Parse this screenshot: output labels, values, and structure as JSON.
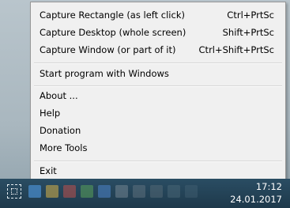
{
  "menu": {
    "items": [
      {
        "label": "Capture Rectangle (as left click)",
        "shortcut": "Ctrl+PrtSc"
      },
      {
        "label": "Capture Desktop (whole screen)",
        "shortcut": "Shift+PrtSc"
      },
      {
        "label": "Capture Window (or part of it)",
        "shortcut": "Ctrl+Shift+PrtSc"
      },
      {
        "label": "Start program with Windows",
        "shortcut": ""
      },
      {
        "label": "About ...",
        "shortcut": ""
      },
      {
        "label": "Help",
        "shortcut": ""
      },
      {
        "label": "Donation",
        "shortcut": ""
      },
      {
        "label": "More Tools",
        "shortcut": ""
      },
      {
        "label": "Exit",
        "shortcut": ""
      }
    ]
  },
  "taskbar": {
    "clock_time": "17:12",
    "clock_date": "24.01.2017",
    "tray_icons": [
      "capture-tray-icon",
      "blue-app-icon",
      "yellow-app-icon",
      "red-app-icon",
      "green-app-icon",
      "blue-app-icon-2",
      "gray-app-icon",
      "gray-app-icon-2"
    ]
  },
  "colors": {
    "menu_bg": "#f0f0f0",
    "taskbar_bg": "#244357",
    "text": "#000000"
  }
}
